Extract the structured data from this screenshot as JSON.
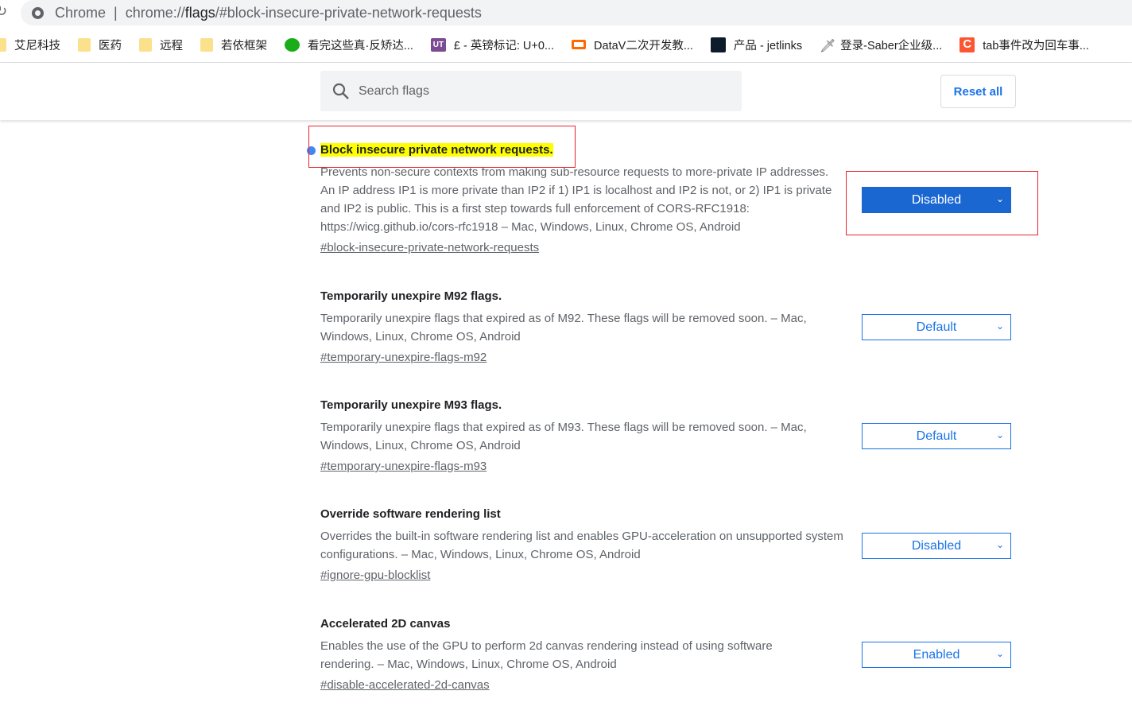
{
  "browser": {
    "app_name": "Chrome",
    "url_prefix": "chrome://",
    "url_host": "flags",
    "url_rest": "/#block-insecure-private-network-requests"
  },
  "bookmarks": [
    {
      "label": "艾尼科技",
      "icon": "folder-icon"
    },
    {
      "label": "医药",
      "icon": "folder-icon"
    },
    {
      "label": "远程",
      "icon": "folder-icon"
    },
    {
      "label": "若依框架",
      "icon": "folder-icon"
    },
    {
      "label": "看完这些真·反矫达...",
      "icon": "wechat-icon"
    },
    {
      "label": "£ - 英镑标记: U+0...",
      "icon": "ut-icon"
    },
    {
      "label": "DataV二次开发教...",
      "icon": "datav-icon"
    },
    {
      "label": "产品 - jetlinks",
      "icon": "jetlinks-icon"
    },
    {
      "label": "登录-Saber企业级...",
      "icon": "sword-icon"
    },
    {
      "label": "tab事件改为回车事...",
      "icon": "csdn-icon"
    }
  ],
  "header": {
    "search_placeholder": "Search flags",
    "reset_label": "Reset all"
  },
  "flags": [
    {
      "title": "Block insecure private network requests.",
      "description": "Prevents non-secure contexts from making sub-resource requests to more-private IP addresses. An IP address IP1 is more private than IP2 if 1) IP1 is localhost and IP2 is not, or 2) IP1 is private and IP2 is public. This is a first step towards full enforcement of CORS-RFC1918: https://wicg.github.io/cors-rfc1918 – Mac, Windows, Linux, Chrome OS, Android",
      "link": "#block-insecure-private-network-requests",
      "value": "Disabled",
      "highlighted": true
    },
    {
      "title": "Temporarily unexpire M92 flags.",
      "description": "Temporarily unexpire flags that expired as of M92. These flags will be removed soon. – Mac, Windows, Linux, Chrome OS, Android",
      "link": "#temporary-unexpire-flags-m92",
      "value": "Default"
    },
    {
      "title": "Temporarily unexpire M93 flags.",
      "description": "Temporarily unexpire flags that expired as of M93. These flags will be removed soon. – Mac, Windows, Linux, Chrome OS, Android",
      "link": "#temporary-unexpire-flags-m93",
      "value": "Default"
    },
    {
      "title": "Override software rendering list",
      "description": "Overrides the built-in software rendering list and enables GPU-acceleration on unsupported system configurations. – Mac, Windows, Linux, Chrome OS, Android",
      "link": "#ignore-gpu-blocklist",
      "value": "Disabled"
    },
    {
      "title": "Accelerated 2D canvas",
      "description": "Enables the use of the GPU to perform 2d canvas rendering instead of using software rendering. – Mac, Windows, Linux, Chrome OS, Android",
      "link": "#disable-accelerated-2d-canvas",
      "value": "Enabled"
    }
  ],
  "colors": {
    "accent": "#1a73e8",
    "highlight": "#ffff00",
    "annotation": "#e8242b"
  }
}
